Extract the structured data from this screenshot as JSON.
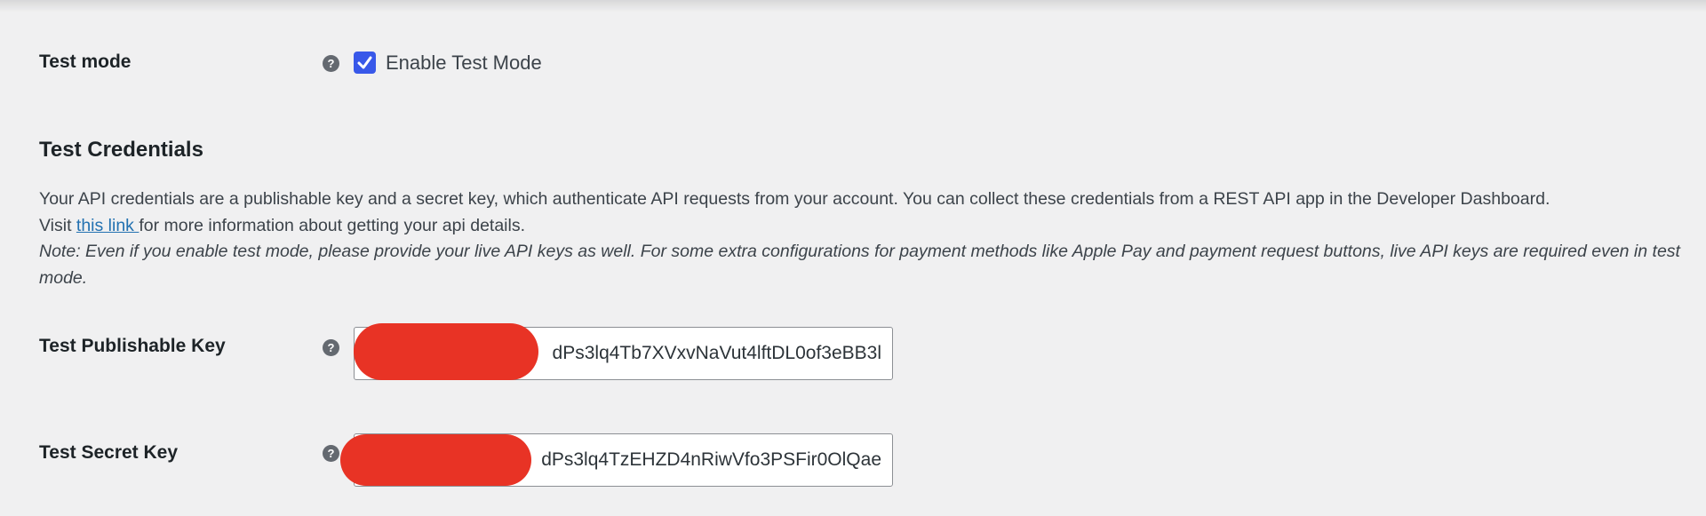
{
  "test_mode": {
    "label": "Test mode",
    "help_icon": "question-mark-icon",
    "checkbox_checked": true,
    "checkbox_label": "Enable Test Mode"
  },
  "credentials": {
    "title": "Test Credentials",
    "desc_line1": "Your API credentials are a publishable key and a secret key, which authenticate API requests from your account. You can collect these credentials from a REST API app in the Developer Dashboard.",
    "desc_visit": "Visit ",
    "desc_link": "this link ",
    "desc_after_link": "for more information about getting your api details.",
    "note": "Note: Even if you enable test mode, please provide your live API keys as well. For some extra configurations for payment methods like Apple Pay and payment request buttons, live API keys are required even in test mode."
  },
  "publishable_key": {
    "label": "Test Publishable Key",
    "value": "dPs3lq4Tb7XVxvNaVut4lftDL0of3eBB3l"
  },
  "secret_key": {
    "label": "Test Secret Key",
    "value": "dPs3lq4TzEHZD4nRiwVfo3PSFir0OlQae"
  },
  "colors": {
    "accent": "#3858e9",
    "link": "#2271b1",
    "redaction": "#e83325",
    "background": "#f0f0f1"
  }
}
